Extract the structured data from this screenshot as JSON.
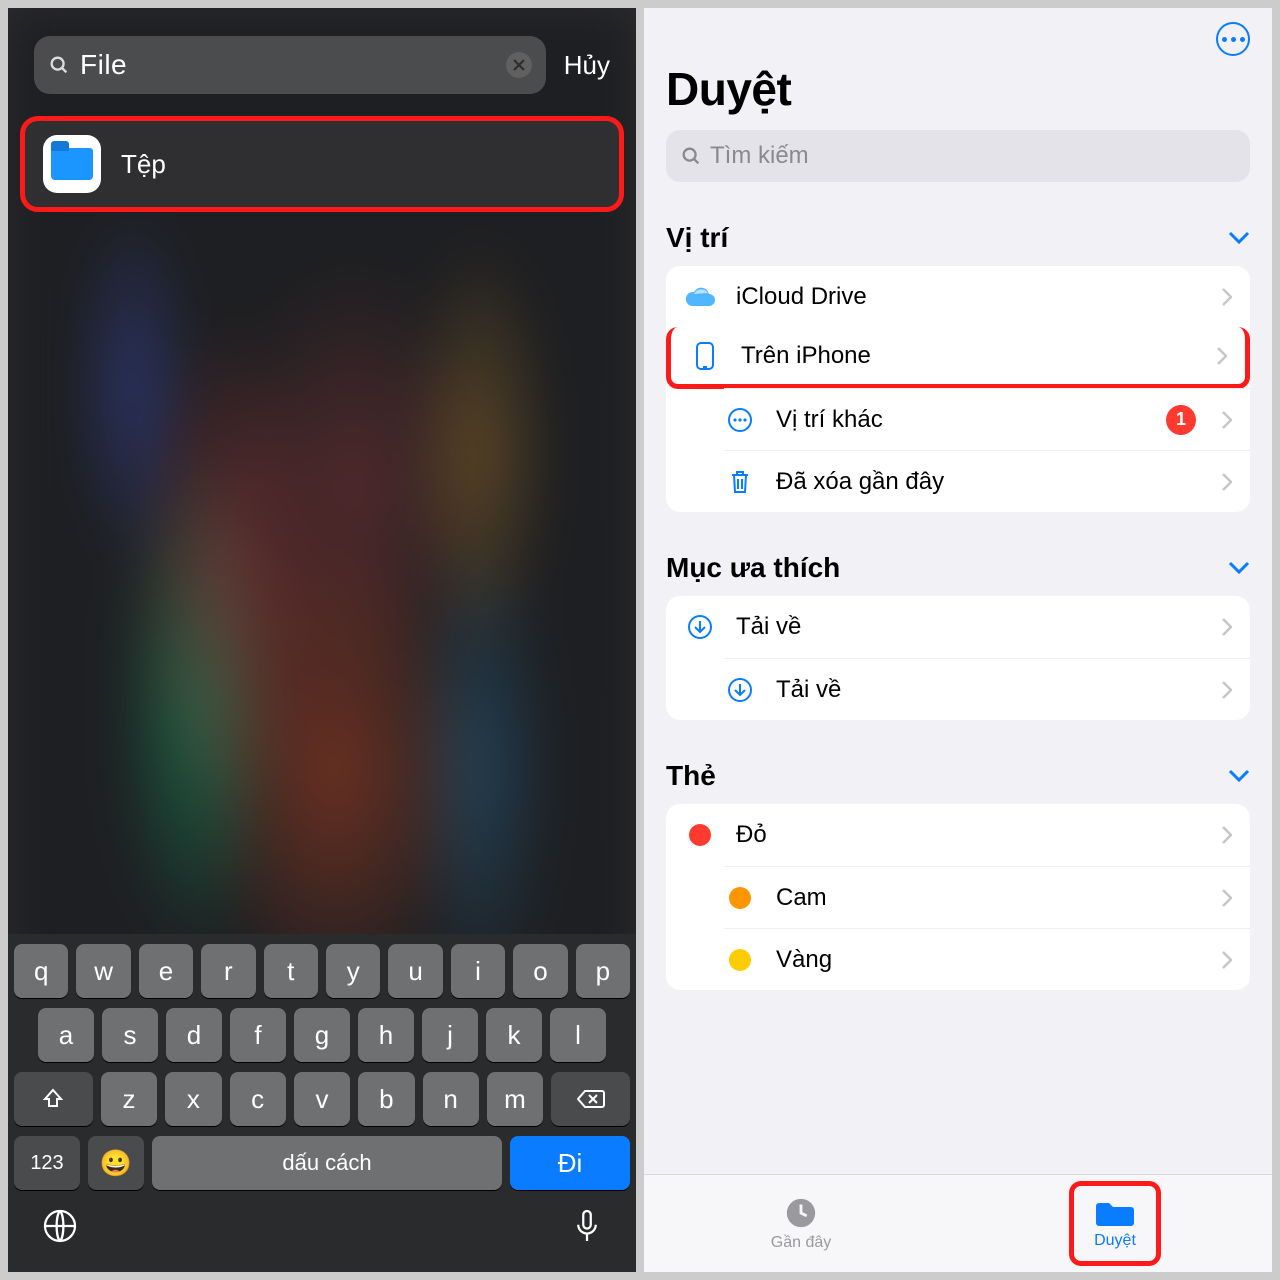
{
  "left": {
    "search_value": "File",
    "cancel_label": "Hủy",
    "result_label": "Tệp",
    "keyboard": {
      "row1": [
        "q",
        "w",
        "e",
        "r",
        "t",
        "y",
        "u",
        "i",
        "o",
        "p"
      ],
      "row2": [
        "a",
        "s",
        "d",
        "f",
        "g",
        "h",
        "j",
        "k",
        "l"
      ],
      "row3": [
        "z",
        "x",
        "c",
        "v",
        "b",
        "n",
        "m"
      ],
      "num_label": "123",
      "space_label": "dấu cách",
      "go_label": "Đi"
    }
  },
  "right": {
    "title": "Duyệt",
    "search_placeholder": "Tìm kiếm",
    "sections": {
      "locations_title": "Vị trí",
      "favorites_title": "Mục ưa thích",
      "tags_title": "Thẻ"
    },
    "locations": [
      {
        "label": "iCloud Drive"
      },
      {
        "label": "Trên iPhone"
      },
      {
        "label": "Vị trí khác"
      },
      {
        "label": "Đã xóa gần đây"
      }
    ],
    "locations_badge": "1",
    "favorites": [
      {
        "label": "Tải về"
      },
      {
        "label": "Tải về"
      }
    ],
    "tags": [
      {
        "label": "Đỏ",
        "color": "#ff3b30"
      },
      {
        "label": "Cam",
        "color": "#ff9500"
      },
      {
        "label": "Vàng",
        "color": "#ffcc00"
      }
    ],
    "tabs": {
      "recents": "Gần đây",
      "browse": "Duyệt"
    }
  }
}
